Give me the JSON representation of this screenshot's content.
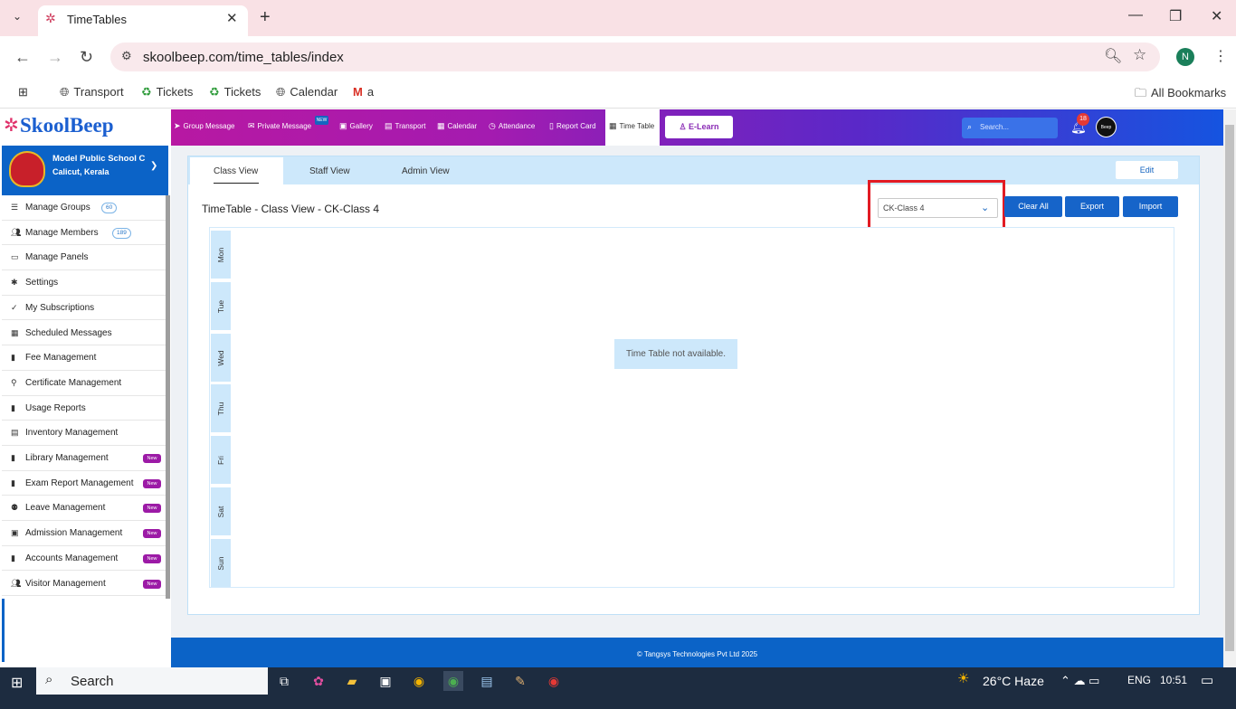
{
  "browser": {
    "tab_title": "TimeTables",
    "url": "skoolbeep.com/time_tables/index",
    "profile_initial": "N",
    "bookmarks": [
      "Transport",
      "Tickets",
      "Tickets",
      "Calendar",
      "a"
    ],
    "all_bookmarks": "All Bookmarks"
  },
  "app": {
    "logo": "SkoolBeep",
    "nav": [
      "Group Message",
      "Private Message",
      "Gallery",
      "Transport",
      "Calendar",
      "Attendance",
      "Report Card",
      "Time Table"
    ],
    "private_message_badge": "NEW",
    "elearn_label": "E-Learn",
    "search_placeholder": "Search...",
    "notification_count": "18",
    "avatar_text": "Beep"
  },
  "school": {
    "name": "Model Public School C",
    "location": "Calicut, Kerala"
  },
  "sidebar": {
    "items": [
      {
        "label": "Manage Groups",
        "count": "60",
        "icon": "list-icon"
      },
      {
        "label": "Manage Members",
        "count": "189",
        "icon": "users-icon"
      },
      {
        "label": "Manage Panels",
        "icon": "monitor-icon"
      },
      {
        "label": "Settings",
        "icon": "gear-icon"
      },
      {
        "label": "My Subscriptions",
        "icon": "check-double-icon"
      },
      {
        "label": "Scheduled Messages",
        "icon": "calendar-icon"
      },
      {
        "label": "Fee Management",
        "icon": "file-icon"
      },
      {
        "label": "Certificate Management",
        "icon": "award-icon"
      },
      {
        "label": "Usage Reports",
        "icon": "bar-chart-icon"
      },
      {
        "label": "Inventory Management",
        "icon": "inventory-icon"
      },
      {
        "label": "Library Management",
        "new": "New",
        "icon": "book-icon"
      },
      {
        "label": "Exam Report Management",
        "new": "New",
        "icon": "file-icon"
      },
      {
        "label": "Leave Management",
        "new": "New",
        "icon": "user-slash-icon"
      },
      {
        "label": "Admission Management",
        "new": "New",
        "icon": "id-card-icon"
      },
      {
        "label": "Accounts Management",
        "new": "New",
        "icon": "file-icon"
      },
      {
        "label": "Visitor Management",
        "new": "New",
        "icon": "users-icon"
      }
    ]
  },
  "timetable": {
    "tabs": [
      "Class View",
      "Staff View",
      "Admin View"
    ],
    "edit_label": "Edit",
    "heading": "TimeTable - Class View - CK-Class 4",
    "selected_class": "CK-Class 4",
    "buttons": {
      "clear_all": "Clear All",
      "export": "Export",
      "import": "Import"
    },
    "days": [
      "Mon",
      "Tue",
      "Wed",
      "Thu",
      "Fri",
      "Sat",
      "Sun"
    ],
    "empty_message": "Time Table not available."
  },
  "footer": "© Tangsys Technologies Pvt Ltd 2025",
  "taskbar": {
    "search_label": "Search",
    "temperature": "26°C",
    "weather": "Haze",
    "language": "ENG",
    "time": "10:51"
  },
  "colors": {
    "accent_blue": "#0b63c7",
    "highlight_red": "#e21b23",
    "new_badge": "#9c1aa6"
  }
}
